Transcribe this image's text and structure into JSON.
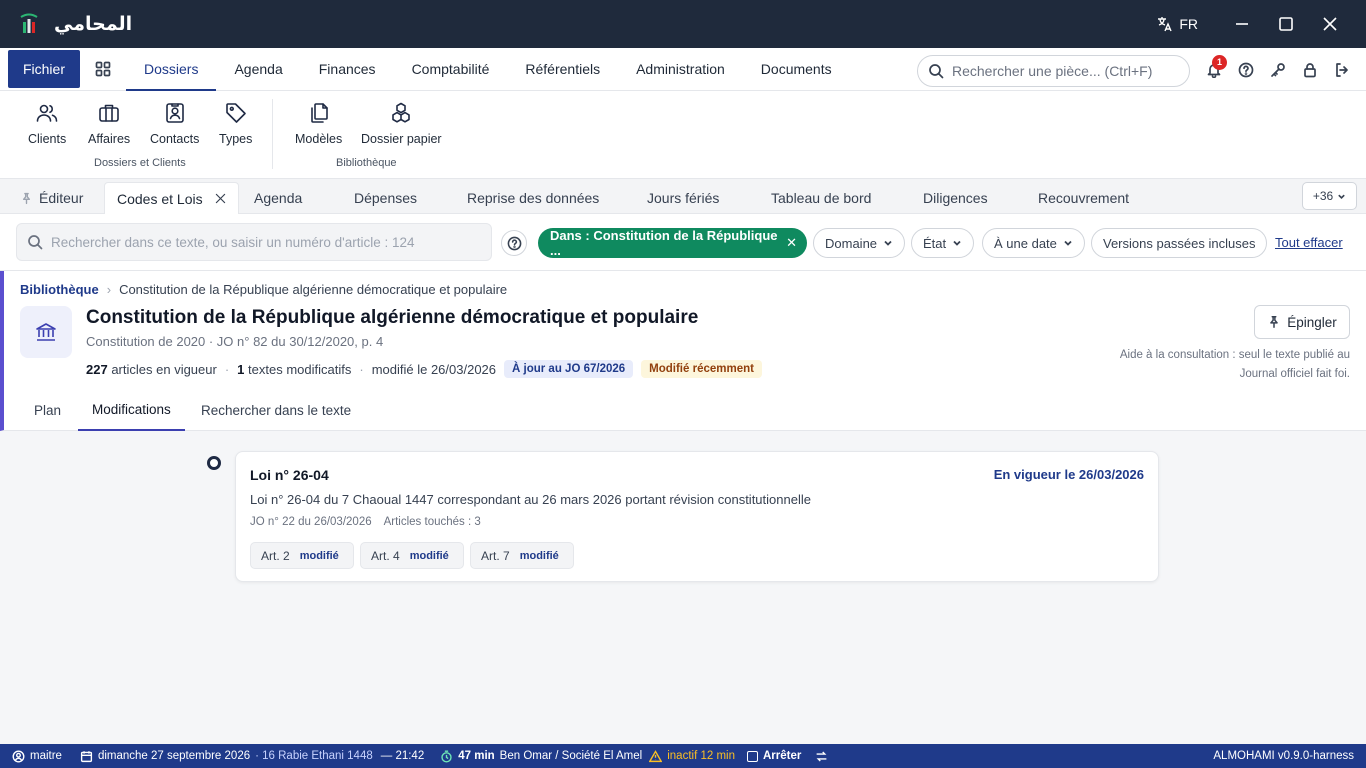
{
  "app": {
    "title": "المحامي",
    "language": "FR"
  },
  "menu": {
    "fichier": "Fichier",
    "items": [
      "Dossiers",
      "Agenda",
      "Finances",
      "Comptabilité",
      "Référentiels",
      "Administration",
      "Documents"
    ],
    "active": "Dossiers",
    "search_placeholder": "Rechercher une pièce... (Ctrl+F)",
    "notification_count": "1"
  },
  "ribbon": {
    "group1": {
      "label": "Dossiers et Clients",
      "buttons": [
        "Clients",
        "Affaires",
        "Contacts",
        "Types"
      ]
    },
    "group2": {
      "label": "Bibliothèque",
      "buttons": [
        "Modèles",
        "Dossier papier"
      ]
    }
  },
  "tabs": {
    "items": [
      "Éditeur",
      "Codes et Lois",
      "Agenda",
      "Dépenses",
      "Reprise des données",
      "Jours fériés",
      "Tableau de bord",
      "Diligences",
      "Recouvrement"
    ],
    "active": "Codes et Lois",
    "more": "+36"
  },
  "filters": {
    "search_placeholder": "Rechercher dans ce texte, ou saisir un numéro d'article : 124",
    "active_chip": "Dans : Constitution de la République ...",
    "domaine": "Domaine",
    "etat": "État",
    "date": "À une date",
    "versions": "Versions passées incluses",
    "clear": "Tout effacer"
  },
  "doc": {
    "breadcrumb_root": "Bibliothèque",
    "breadcrumb_current": "Constitution de la République algérienne démocratique et populaire",
    "title": "Constitution de la République algérienne démocratique et populaire",
    "subtitle": "Constitution de 2020  · JO n° 82 du 30/12/2020, p. 4",
    "articles_count": "227",
    "articles_label": "articles en vigueur",
    "mod_count": "1",
    "mod_label": "textes modificatifs",
    "modified": "modifié le 26/03/2026",
    "tag_uptodate": "À jour au JO 67/2026",
    "tag_recent": "Modifié récemment",
    "pin_label": "Épingler",
    "aide": "Aide à la consultation : seul le texte publié au Journal officiel fait foi.",
    "subtabs": [
      "Plan",
      "Modifications",
      "Rechercher dans le texte"
    ],
    "active_subtab": "Modifications"
  },
  "modification": {
    "title": "Loi n° 26-04",
    "status": "En vigueur le 26/03/2026",
    "description": "Loi n° 26-04 du 7 Chaoual 1447 correspondant au 26 mars 2026 portant révision constitutionnelle",
    "jo": "JO n° 22 du 26/03/2026",
    "articles_touched": "Articles touchés : 3",
    "articles": [
      {
        "label": "Art. 2",
        "status": "modifié"
      },
      {
        "label": "Art. 4",
        "status": "modifié"
      },
      {
        "label": "Art. 7",
        "status": "modifié"
      }
    ]
  },
  "status": {
    "user": "maitre",
    "date": "dimanche 27 septembre 2026",
    "hijri": "· 16 Rabie Ethani 1448",
    "time": "— 21:42",
    "timer": "47 min",
    "client": "Ben Omar / Société El Amel",
    "inactive": "inactif 12 min",
    "stop": "Arrêter",
    "version": "ALMOHAMI v0.9.0-harness"
  },
  "colors": {
    "primary": "#1f3a8a",
    "titlebar": "#1f2a3c",
    "green": "#0f8a5f",
    "accent_bar": "#5b4fcf"
  },
  "icons": [
    "logo-icon",
    "translate-icon",
    "minimize-icon",
    "maximize-icon",
    "close-icon",
    "grid-icon",
    "search-icon",
    "bell-icon",
    "help-icon",
    "key-icon",
    "lock-icon",
    "logout-icon",
    "users-icon",
    "briefcase-icon",
    "contact-card-icon",
    "tag-icon",
    "copy-icon",
    "boxes-icon",
    "pin-icon",
    "bank-icon",
    "user-icon",
    "calendar-icon",
    "timer-icon",
    "warning-icon",
    "refresh-icon"
  ]
}
